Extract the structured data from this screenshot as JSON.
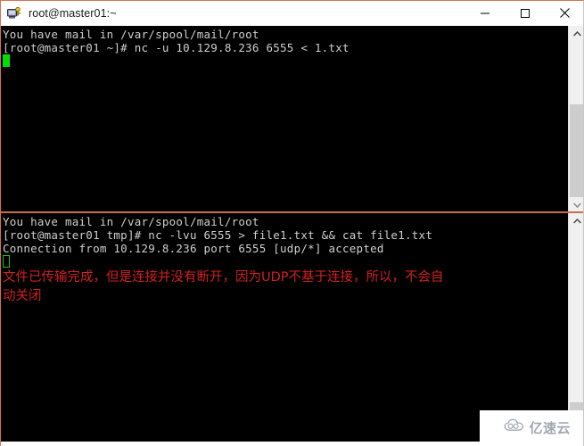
{
  "window": {
    "title": "root@master01:~",
    "icon": "putty-icon",
    "controls": [
      {
        "name": "minimize-button",
        "glyph": "minimize-icon"
      },
      {
        "name": "maximize-button",
        "glyph": "maximize-icon"
      },
      {
        "name": "close-button",
        "glyph": "close-icon"
      }
    ]
  },
  "panes": {
    "top": {
      "lines": [
        "You have mail in /var/spool/mail/root",
        "[root@master01 ~]# nc -u 10.129.8.236 6555 < 1.txt"
      ],
      "cursor": "solid-green-block",
      "scrollbar": {
        "up": "chevron-up-icon",
        "down": "chevron-down-icon"
      }
    },
    "bottom": {
      "lines": [
        "You have mail in /var/spool/mail/root",
        "[root@master01 tmp]# nc -lvu 6555 > file1.txt && cat file1.txt",
        "Connection from 10.129.8.236 port 6555 [udp/*] accepted"
      ],
      "cursor": "hollow-green-block",
      "annotation": [
        "文件已传输完成，但是连接并没有断开，因为UDP不基于连接，所以，不会自",
        "动关闭"
      ],
      "scrollbar": {
        "up": "chevron-up-icon",
        "down": "chevron-down-icon"
      }
    }
  },
  "watermark": {
    "text": "亿速云",
    "icon": "cloud-icon"
  },
  "colors": {
    "terminal_bg": "#000000",
    "terminal_fg": "#cfcfcf",
    "annotation_red": "#d22020",
    "cursor_green": "#00e000",
    "divider": "#c4714b"
  }
}
